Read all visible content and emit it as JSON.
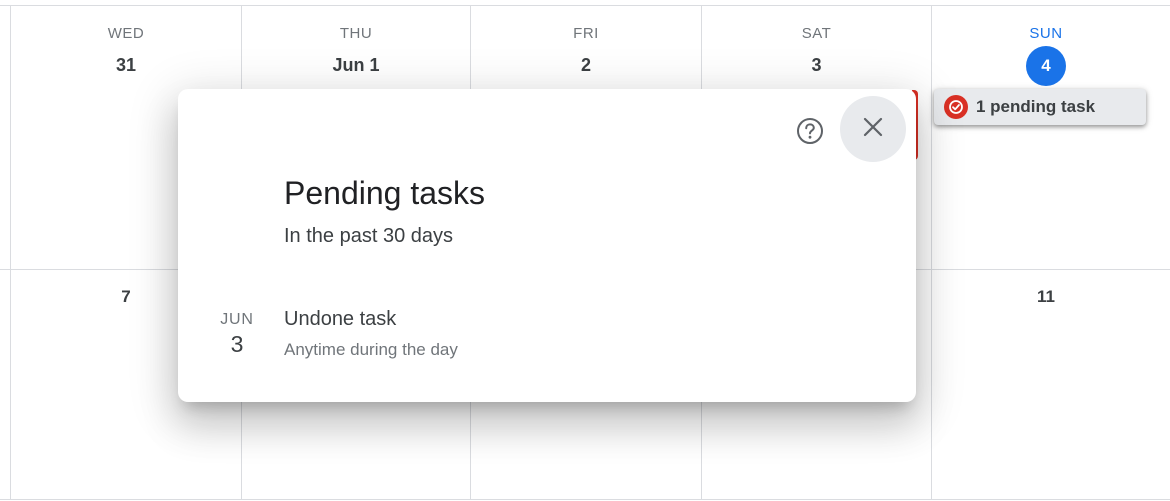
{
  "calendar": {
    "week1": [
      {
        "dow": "WED",
        "day": "31"
      },
      {
        "dow": "THU",
        "day": "Jun 1"
      },
      {
        "dow": "FRI",
        "day": "2"
      },
      {
        "dow": "SAT",
        "day": "3"
      },
      {
        "dow": "SUN",
        "day": "4",
        "today": true
      }
    ],
    "week2_visible": {
      "first": "7",
      "last": "11"
    },
    "pending_chip_label": "1 pending task",
    "today_color": "#1a73e8",
    "task_color": "#d93025"
  },
  "dialog": {
    "title": "Pending tasks",
    "subtitle": "In the past 30 days",
    "help_icon": "help-circle-icon",
    "close_icon": "close-icon",
    "tasks": [
      {
        "month": "JUN",
        "day": "3",
        "name": "Undone task",
        "time": "Anytime during the day"
      }
    ]
  }
}
